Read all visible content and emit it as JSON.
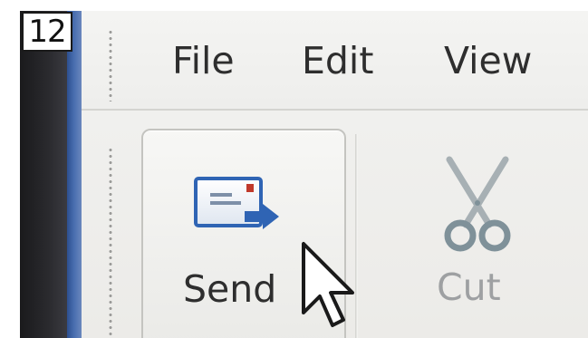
{
  "step_number": "12",
  "menubar": {
    "items": [
      {
        "label": "File"
      },
      {
        "label": "Edit"
      },
      {
        "label": "View"
      }
    ]
  },
  "toolbar": {
    "send": {
      "label": "Send",
      "icon": "send-mail-icon"
    },
    "cut": {
      "label": "Cut",
      "icon": "scissors-icon",
      "state": "disabled"
    }
  },
  "cursor": {
    "icon": "mouse-pointer-icon"
  },
  "colors": {
    "window_border": "#4a6fb0",
    "menubar_bg": "#f4f4f2",
    "toolbar_bg": "#eeeeec",
    "text": "#2e2e2e",
    "disabled_text": "#9ea0a2",
    "send_icon_blue": "#2f64b4",
    "bezel": "#1a1a1c"
  }
}
